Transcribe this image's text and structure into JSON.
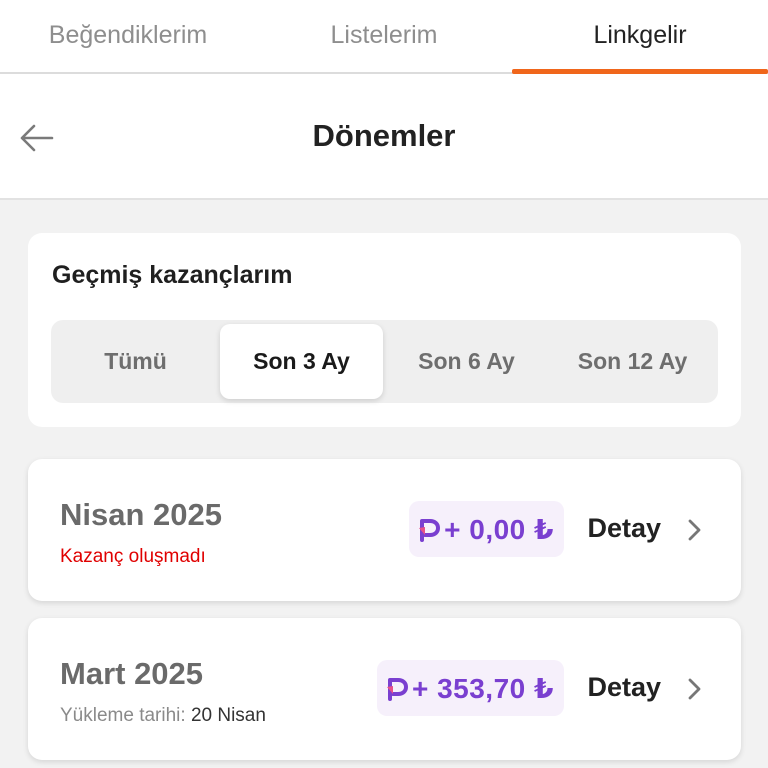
{
  "top_tabs": [
    {
      "label": "Beğendiklerim",
      "active": false
    },
    {
      "label": "Listelerim",
      "active": false
    },
    {
      "label": "Linkgelir",
      "active": true
    }
  ],
  "header": {
    "title": "Dönemler",
    "back_icon": "arrow-left-icon"
  },
  "filter": {
    "title": "Geçmiş kazançlarım",
    "options": [
      "Tümü",
      "Son 3 Ay",
      "Son 6 Ay",
      "Son 12 Ay"
    ],
    "selected": "Son 3 Ay"
  },
  "periods": [
    {
      "name": "Nisan 2025",
      "status": "Kazanç oluşmadı",
      "amount": "+ 0,00 ₺",
      "detail_label": "Detay"
    },
    {
      "name": "Mart 2025",
      "upload_label": "Yükleme tarihi:",
      "upload_date": "20 Nisan",
      "amount": "+ 353,70 ₺",
      "detail_label": "Detay"
    }
  ],
  "colors": {
    "accent": "#f0661b",
    "amount": "#7a3fd0",
    "amount_bg": "#f6f0fb",
    "status_error": "#e00000"
  }
}
